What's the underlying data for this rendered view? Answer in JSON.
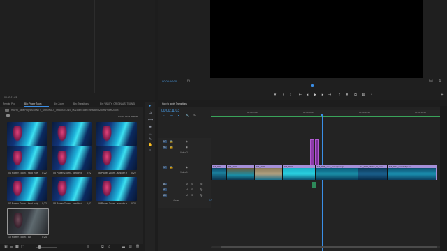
{
  "source_monitor": {
    "timecode": "00:00:11:03"
  },
  "program_monitor": {
    "timecode": "00:00:16:00",
    "fit": "Fit",
    "quality": "Full",
    "ratio": "1/4"
  },
  "project_panel": {
    "tabs": [
      "Remote Pro",
      "Bin: Power Zoom",
      "Bin: Zoom",
      "Bin: Transitions",
      "Bin: VANITY_ORIGINALS_TRANSI"
    ],
    "path": "How to_Jaxe Projects\\VANITY_ORIGINALS_TRANSITIONS_4K\\Zoom\\Zoom\\Transitions\\Zoom\\Power Zoom",
    "items_info": "1 of 10 items selected",
    "items": [
      {
        "name": "01 Power Zoom - hard in...",
        "dur": "0;24"
      },
      {
        "name": "02 Power Zoom - hard in fad...",
        "dur": "0;24"
      },
      {
        "name": "03 Power Zoom - smooth in...",
        "dur": "0;24"
      },
      {
        "name": "04 Power Zoom - hard in left",
        "dur": "0;22"
      },
      {
        "name": "05 Power Zoom - hard in left...",
        "dur": "0;22"
      },
      {
        "name": "06 Power Zoom - smooth in...",
        "dur": "0;22"
      },
      {
        "name": "07 Power Zoom - hard in rig...",
        "dur": "0;22"
      },
      {
        "name": "08 Power Zoom - hard in rig...",
        "dur": "0;22"
      },
      {
        "name": "09 Power Zoom - smooth in ri...",
        "dur": "0;22"
      },
      {
        "name": "10 Power Zoom - out",
        "dur": "0;24"
      }
    ]
  },
  "timeline": {
    "tab": "How to apply Transitions",
    "timecode": "00:00:11:03",
    "ruler": [
      "00:00:04:23",
      "00:00:09:23",
      "00:00:14:23",
      "00:00:19:23"
    ],
    "tracks_video": [
      "V3",
      "V2",
      "V1"
    ],
    "video2_label": "Video 2",
    "video1_label": "Video 1",
    "tracks_audio": [
      "A1",
      "A2",
      "A3"
    ],
    "master_label": "Master",
    "master_value": "0.0",
    "clips": [
      {
        "label": "DJI_0001..."
      },
      {
        "label": "DJI_0002..."
      },
      {
        "label": "DJI_0003..."
      },
      {
        "label": "DJI_0004..."
      },
      {
        "label": "DJI_0005_cave_water_beauga"
      },
      {
        "label": "DJI_0006_Marble_bl_water"
      },
      {
        "label": "DJI_0013_waterfall_fence..."
      }
    ]
  },
  "colors": {
    "accent": "#3a8ee6",
    "clip_header": "#a58fd8",
    "transition": "#8c3aa8",
    "bg": "#1d1d1d"
  }
}
